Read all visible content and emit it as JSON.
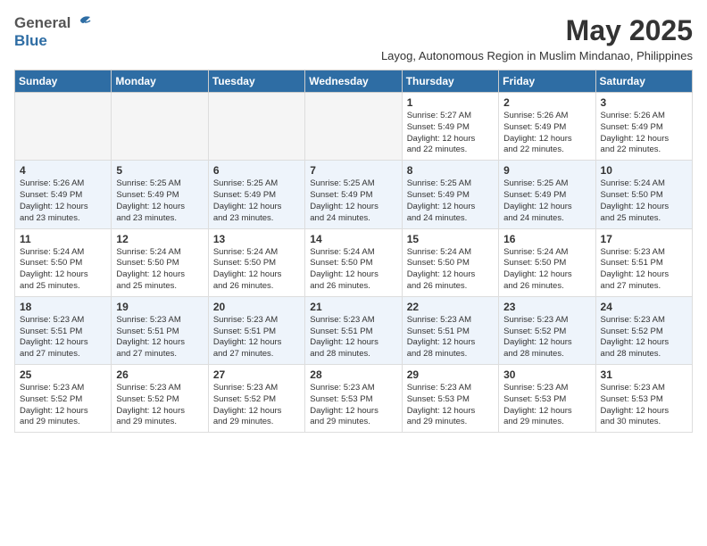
{
  "header": {
    "logo_general": "General",
    "logo_blue": "Blue",
    "month_title": "May 2025",
    "subtitle": "Layog, Autonomous Region in Muslim Mindanao, Philippines"
  },
  "weekdays": [
    "Sunday",
    "Monday",
    "Tuesday",
    "Wednesday",
    "Thursday",
    "Friday",
    "Saturday"
  ],
  "weeks": [
    [
      {
        "day": "",
        "info": ""
      },
      {
        "day": "",
        "info": ""
      },
      {
        "day": "",
        "info": ""
      },
      {
        "day": "",
        "info": ""
      },
      {
        "day": "1",
        "info": "Sunrise: 5:27 AM\nSunset: 5:49 PM\nDaylight: 12 hours\nand 22 minutes."
      },
      {
        "day": "2",
        "info": "Sunrise: 5:26 AM\nSunset: 5:49 PM\nDaylight: 12 hours\nand 22 minutes."
      },
      {
        "day": "3",
        "info": "Sunrise: 5:26 AM\nSunset: 5:49 PM\nDaylight: 12 hours\nand 22 minutes."
      }
    ],
    [
      {
        "day": "4",
        "info": "Sunrise: 5:26 AM\nSunset: 5:49 PM\nDaylight: 12 hours\nand 23 minutes."
      },
      {
        "day": "5",
        "info": "Sunrise: 5:25 AM\nSunset: 5:49 PM\nDaylight: 12 hours\nand 23 minutes."
      },
      {
        "day": "6",
        "info": "Sunrise: 5:25 AM\nSunset: 5:49 PM\nDaylight: 12 hours\nand 23 minutes."
      },
      {
        "day": "7",
        "info": "Sunrise: 5:25 AM\nSunset: 5:49 PM\nDaylight: 12 hours\nand 24 minutes."
      },
      {
        "day": "8",
        "info": "Sunrise: 5:25 AM\nSunset: 5:49 PM\nDaylight: 12 hours\nand 24 minutes."
      },
      {
        "day": "9",
        "info": "Sunrise: 5:25 AM\nSunset: 5:49 PM\nDaylight: 12 hours\nand 24 minutes."
      },
      {
        "day": "10",
        "info": "Sunrise: 5:24 AM\nSunset: 5:50 PM\nDaylight: 12 hours\nand 25 minutes."
      }
    ],
    [
      {
        "day": "11",
        "info": "Sunrise: 5:24 AM\nSunset: 5:50 PM\nDaylight: 12 hours\nand 25 minutes."
      },
      {
        "day": "12",
        "info": "Sunrise: 5:24 AM\nSunset: 5:50 PM\nDaylight: 12 hours\nand 25 minutes."
      },
      {
        "day": "13",
        "info": "Sunrise: 5:24 AM\nSunset: 5:50 PM\nDaylight: 12 hours\nand 26 minutes."
      },
      {
        "day": "14",
        "info": "Sunrise: 5:24 AM\nSunset: 5:50 PM\nDaylight: 12 hours\nand 26 minutes."
      },
      {
        "day": "15",
        "info": "Sunrise: 5:24 AM\nSunset: 5:50 PM\nDaylight: 12 hours\nand 26 minutes."
      },
      {
        "day": "16",
        "info": "Sunrise: 5:24 AM\nSunset: 5:50 PM\nDaylight: 12 hours\nand 26 minutes."
      },
      {
        "day": "17",
        "info": "Sunrise: 5:23 AM\nSunset: 5:51 PM\nDaylight: 12 hours\nand 27 minutes."
      }
    ],
    [
      {
        "day": "18",
        "info": "Sunrise: 5:23 AM\nSunset: 5:51 PM\nDaylight: 12 hours\nand 27 minutes."
      },
      {
        "day": "19",
        "info": "Sunrise: 5:23 AM\nSunset: 5:51 PM\nDaylight: 12 hours\nand 27 minutes."
      },
      {
        "day": "20",
        "info": "Sunrise: 5:23 AM\nSunset: 5:51 PM\nDaylight: 12 hours\nand 27 minutes."
      },
      {
        "day": "21",
        "info": "Sunrise: 5:23 AM\nSunset: 5:51 PM\nDaylight: 12 hours\nand 28 minutes."
      },
      {
        "day": "22",
        "info": "Sunrise: 5:23 AM\nSunset: 5:51 PM\nDaylight: 12 hours\nand 28 minutes."
      },
      {
        "day": "23",
        "info": "Sunrise: 5:23 AM\nSunset: 5:52 PM\nDaylight: 12 hours\nand 28 minutes."
      },
      {
        "day": "24",
        "info": "Sunrise: 5:23 AM\nSunset: 5:52 PM\nDaylight: 12 hours\nand 28 minutes."
      }
    ],
    [
      {
        "day": "25",
        "info": "Sunrise: 5:23 AM\nSunset: 5:52 PM\nDaylight: 12 hours\nand 29 minutes."
      },
      {
        "day": "26",
        "info": "Sunrise: 5:23 AM\nSunset: 5:52 PM\nDaylight: 12 hours\nand 29 minutes."
      },
      {
        "day": "27",
        "info": "Sunrise: 5:23 AM\nSunset: 5:52 PM\nDaylight: 12 hours\nand 29 minutes."
      },
      {
        "day": "28",
        "info": "Sunrise: 5:23 AM\nSunset: 5:53 PM\nDaylight: 12 hours\nand 29 minutes."
      },
      {
        "day": "29",
        "info": "Sunrise: 5:23 AM\nSunset: 5:53 PM\nDaylight: 12 hours\nand 29 minutes."
      },
      {
        "day": "30",
        "info": "Sunrise: 5:23 AM\nSunset: 5:53 PM\nDaylight: 12 hours\nand 29 minutes."
      },
      {
        "day": "31",
        "info": "Sunrise: 5:23 AM\nSunset: 5:53 PM\nDaylight: 12 hours\nand 30 minutes."
      }
    ]
  ]
}
